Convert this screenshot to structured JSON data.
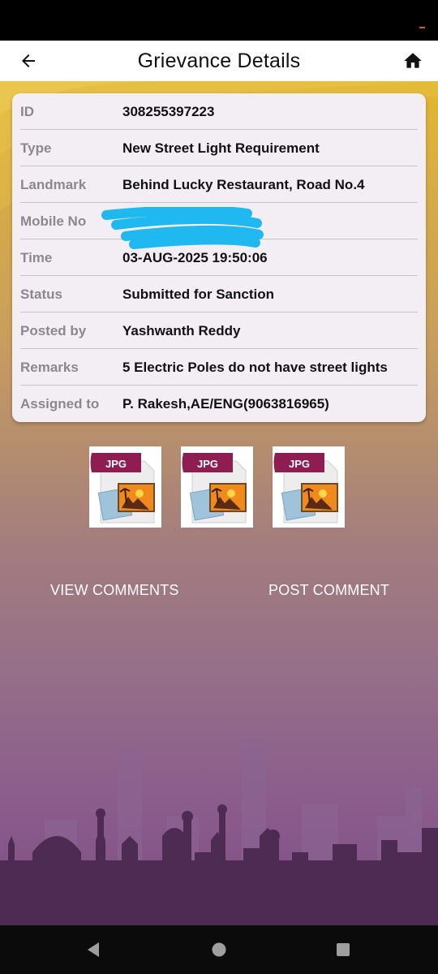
{
  "app_bar": {
    "title": "Grievance Details",
    "back_icon": "arrow-left-icon",
    "home_icon": "home-icon"
  },
  "details": [
    {
      "label": "ID",
      "value": "308255397223"
    },
    {
      "label": "Type",
      "value": "New Street Light Requirement"
    },
    {
      "label": "Landmark",
      "value": "Behind Lucky Restaurant, Road No.4"
    },
    {
      "label": "Mobile No",
      "value": ""
    },
    {
      "label": "Time",
      "value": "03-AUG-2025 19:50:06"
    },
    {
      "label": "Status",
      "value": "Submitted for Sanction"
    },
    {
      "label": "Posted by",
      "value": "Yashwanth Reddy"
    },
    {
      "label": "Remarks",
      "value": "5 Electric Poles do not have street lights"
    },
    {
      "label": "Assigned to",
      "value": "P. Rakesh,AE/ENG(9063816965)"
    }
  ],
  "attachments": [
    {
      "type": "JPG",
      "icon": "jpg-file-icon"
    },
    {
      "type": "JPG",
      "icon": "jpg-file-icon"
    },
    {
      "type": "JPG",
      "icon": "jpg-file-icon"
    }
  ],
  "actions": {
    "view_comments": "VIEW COMMENTS",
    "post_comment": "POST COMMENT"
  },
  "colors": {
    "accent_yellow": "#e2b72e",
    "bg_purple": "#7d4d84",
    "redaction_blue": "#1fb8f0",
    "jpg_badge": "#8e1e52"
  }
}
